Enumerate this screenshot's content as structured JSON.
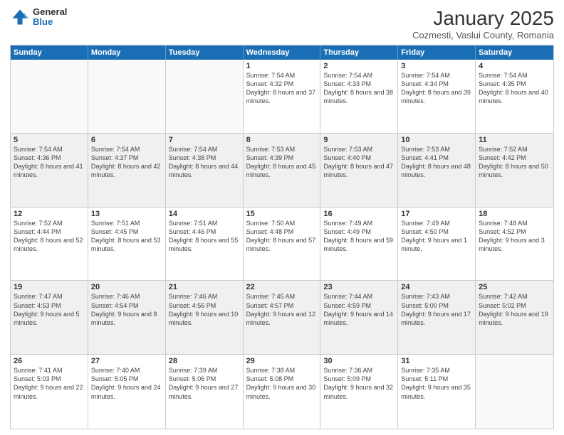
{
  "logo": {
    "general": "General",
    "blue": "Blue"
  },
  "header": {
    "month": "January 2025",
    "location": "Cozmesti, Vaslui County, Romania"
  },
  "weekdays": [
    "Sunday",
    "Monday",
    "Tuesday",
    "Wednesday",
    "Thursday",
    "Friday",
    "Saturday"
  ],
  "rows": [
    [
      {
        "day": "",
        "info": ""
      },
      {
        "day": "",
        "info": ""
      },
      {
        "day": "",
        "info": ""
      },
      {
        "day": "1",
        "info": "Sunrise: 7:54 AM\nSunset: 4:32 PM\nDaylight: 8 hours and 37 minutes."
      },
      {
        "day": "2",
        "info": "Sunrise: 7:54 AM\nSunset: 4:33 PM\nDaylight: 8 hours and 38 minutes."
      },
      {
        "day": "3",
        "info": "Sunrise: 7:54 AM\nSunset: 4:34 PM\nDaylight: 8 hours and 39 minutes."
      },
      {
        "day": "4",
        "info": "Sunrise: 7:54 AM\nSunset: 4:35 PM\nDaylight: 8 hours and 40 minutes."
      }
    ],
    [
      {
        "day": "5",
        "info": "Sunrise: 7:54 AM\nSunset: 4:36 PM\nDaylight: 8 hours and 41 minutes."
      },
      {
        "day": "6",
        "info": "Sunrise: 7:54 AM\nSunset: 4:37 PM\nDaylight: 8 hours and 42 minutes."
      },
      {
        "day": "7",
        "info": "Sunrise: 7:54 AM\nSunset: 4:38 PM\nDaylight: 8 hours and 44 minutes."
      },
      {
        "day": "8",
        "info": "Sunrise: 7:53 AM\nSunset: 4:39 PM\nDaylight: 8 hours and 45 minutes."
      },
      {
        "day": "9",
        "info": "Sunrise: 7:53 AM\nSunset: 4:40 PM\nDaylight: 8 hours and 47 minutes."
      },
      {
        "day": "10",
        "info": "Sunrise: 7:53 AM\nSunset: 4:41 PM\nDaylight: 8 hours and 48 minutes."
      },
      {
        "day": "11",
        "info": "Sunrise: 7:52 AM\nSunset: 4:42 PM\nDaylight: 8 hours and 50 minutes."
      }
    ],
    [
      {
        "day": "12",
        "info": "Sunrise: 7:52 AM\nSunset: 4:44 PM\nDaylight: 8 hours and 52 minutes."
      },
      {
        "day": "13",
        "info": "Sunrise: 7:51 AM\nSunset: 4:45 PM\nDaylight: 8 hours and 53 minutes."
      },
      {
        "day": "14",
        "info": "Sunrise: 7:51 AM\nSunset: 4:46 PM\nDaylight: 8 hours and 55 minutes."
      },
      {
        "day": "15",
        "info": "Sunrise: 7:50 AM\nSunset: 4:48 PM\nDaylight: 8 hours and 57 minutes."
      },
      {
        "day": "16",
        "info": "Sunrise: 7:49 AM\nSunset: 4:49 PM\nDaylight: 8 hours and 59 minutes."
      },
      {
        "day": "17",
        "info": "Sunrise: 7:49 AM\nSunset: 4:50 PM\nDaylight: 9 hours and 1 minute."
      },
      {
        "day": "18",
        "info": "Sunrise: 7:48 AM\nSunset: 4:52 PM\nDaylight: 9 hours and 3 minutes."
      }
    ],
    [
      {
        "day": "19",
        "info": "Sunrise: 7:47 AM\nSunset: 4:53 PM\nDaylight: 9 hours and 5 minutes."
      },
      {
        "day": "20",
        "info": "Sunrise: 7:46 AM\nSunset: 4:54 PM\nDaylight: 9 hours and 8 minutes."
      },
      {
        "day": "21",
        "info": "Sunrise: 7:46 AM\nSunset: 4:56 PM\nDaylight: 9 hours and 10 minutes."
      },
      {
        "day": "22",
        "info": "Sunrise: 7:45 AM\nSunset: 4:57 PM\nDaylight: 9 hours and 12 minutes."
      },
      {
        "day": "23",
        "info": "Sunrise: 7:44 AM\nSunset: 4:59 PM\nDaylight: 9 hours and 14 minutes."
      },
      {
        "day": "24",
        "info": "Sunrise: 7:43 AM\nSunset: 5:00 PM\nDaylight: 9 hours and 17 minutes."
      },
      {
        "day": "25",
        "info": "Sunrise: 7:42 AM\nSunset: 5:02 PM\nDaylight: 9 hours and 19 minutes."
      }
    ],
    [
      {
        "day": "26",
        "info": "Sunrise: 7:41 AM\nSunset: 5:03 PM\nDaylight: 9 hours and 22 minutes."
      },
      {
        "day": "27",
        "info": "Sunrise: 7:40 AM\nSunset: 5:05 PM\nDaylight: 9 hours and 24 minutes."
      },
      {
        "day": "28",
        "info": "Sunrise: 7:39 AM\nSunset: 5:06 PM\nDaylight: 9 hours and 27 minutes."
      },
      {
        "day": "29",
        "info": "Sunrise: 7:38 AM\nSunset: 5:08 PM\nDaylight: 9 hours and 30 minutes."
      },
      {
        "day": "30",
        "info": "Sunrise: 7:36 AM\nSunset: 5:09 PM\nDaylight: 9 hours and 32 minutes."
      },
      {
        "day": "31",
        "info": "Sunrise: 7:35 AM\nSunset: 5:11 PM\nDaylight: 9 hours and 35 minutes."
      },
      {
        "day": "",
        "info": ""
      }
    ]
  ]
}
